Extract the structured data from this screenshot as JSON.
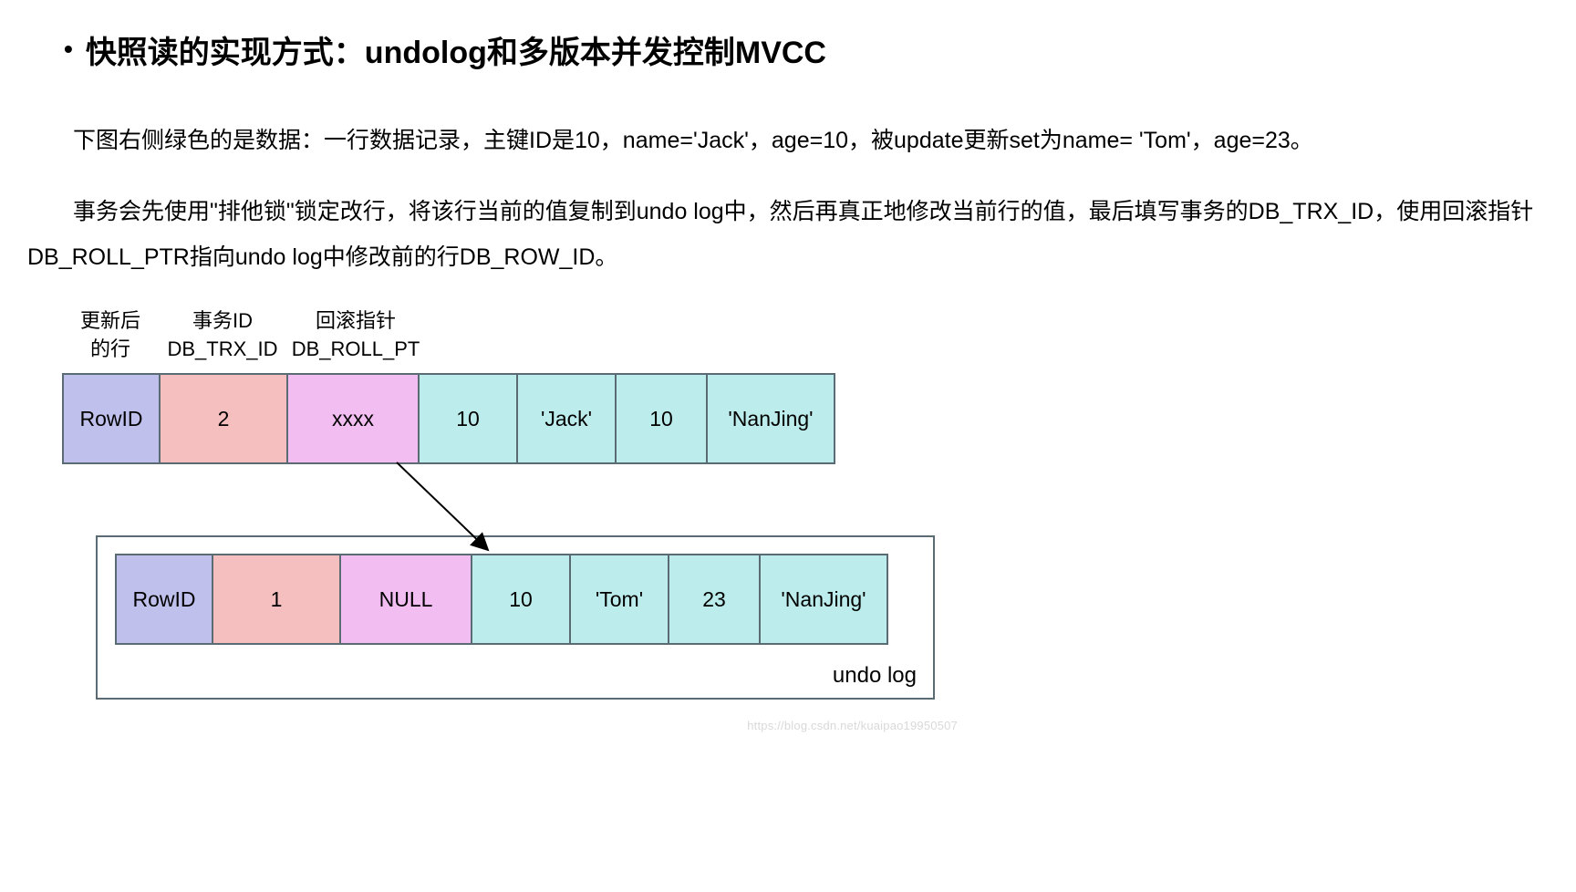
{
  "title": "快照读的实现方式：undolog和多版本并发控制MVCC",
  "para1": "下图右侧绿色的是数据：一行数据记录，主键ID是10，name='Jack'，age=10，被update更新set为name= 'Tom'，age=23。",
  "para2": "事务会先使用\"排他锁\"锁定改行，将该行当前的值复制到undo log中，然后再真正地修改当前行的值，最后填写事务的DB_TRX_ID，使用回滚指针DB_ROLL_PTR指向undo log中修改前的行DB_ROW_ID。",
  "labels": {
    "col1_line1": "更新后",
    "col1_line2": "的行",
    "col2_line1": "事务ID",
    "col2_line2": "DB_TRX_ID",
    "col3_line1": "回滚指针",
    "col3_line2": "DB_ROLL_PT"
  },
  "row1": {
    "rowid": "RowID",
    "trx": "2",
    "ptr": "xxxx",
    "d1": "10",
    "d2": "'Jack'",
    "d3": "10",
    "d4": "'NanJing'"
  },
  "row2": {
    "rowid": "RowID",
    "trx": "1",
    "ptr": "NULL",
    "d1": "10",
    "d2": "'Tom'",
    "d3": "23",
    "d4": "'NanJing'"
  },
  "undo_label": "undo log",
  "watermark": "https://blog.csdn.net/kuaipao19950507",
  "colors": {
    "rowid": "#bfc1ec",
    "trx": "#f6bfbf",
    "ptr": "#f2bdf1",
    "data": "#bdecec",
    "border": "#5b6b73"
  }
}
